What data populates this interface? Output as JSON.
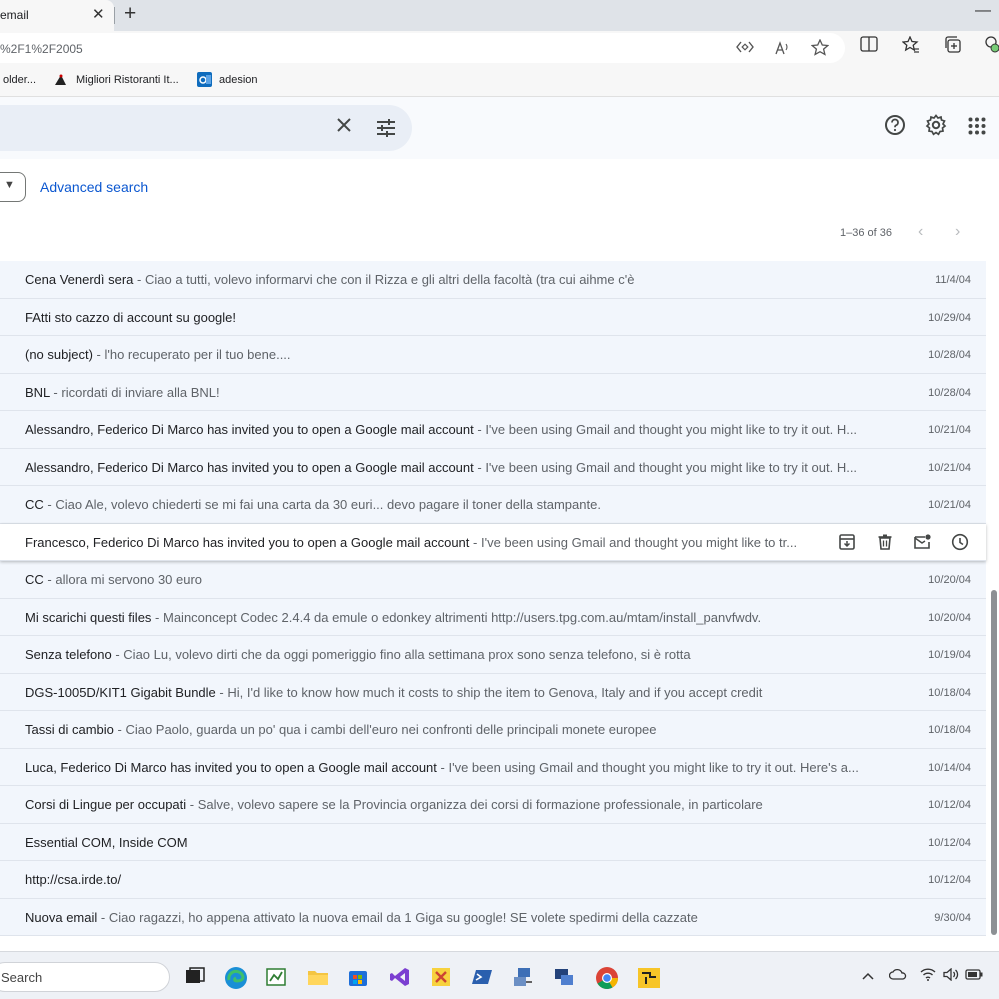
{
  "browser": {
    "tab_title": "email",
    "tab_close": "✕",
    "new_tab": "+",
    "window_minimize": "—",
    "url": "%2F1%2F2005"
  },
  "bookmarks": [
    {
      "label": "older...",
      "icon": "bookmark-icon"
    },
    {
      "label": "Migliori Ristoranti It...",
      "icon": "restaurant-icon"
    },
    {
      "label": "adesion",
      "icon": "outlook-icon"
    }
  ],
  "filters": {
    "advanced_search": "Advanced search"
  },
  "pagination": {
    "text": "1–36 of 36",
    "prev": "‹",
    "next": "›"
  },
  "emails": [
    {
      "subject": "Cena Venerdì sera",
      "snippet": "Ciao a tutti, volevo informarvi che con il Rizza e gli altri della facoltà (tra cui aihme c'è",
      "date": "11/4/04"
    },
    {
      "subject": "FAtti sto cazzo di account su google!",
      "snippet": "",
      "date": "10/29/04"
    },
    {
      "subject": "(no subject)",
      "snippet": "l'ho recuperato per il tuo bene....",
      "date": "10/28/04"
    },
    {
      "subject": "BNL",
      "snippet": "ricordati di inviare alla BNL!",
      "date": "10/28/04"
    },
    {
      "subject": "Alessandro, Federico Di Marco has invited you to open a Google mail account",
      "snippet": "I've been using Gmail and thought you might like to try it out. H...",
      "date": "10/21/04"
    },
    {
      "subject": "Alessandro, Federico Di Marco has invited you to open a Google mail account",
      "snippet": "I've been using Gmail and thought you might like to try it out. H...",
      "date": "10/21/04"
    },
    {
      "subject": "CC",
      "snippet": "Ciao Ale, volevo chiederti se mi fai una carta da 30 euri... devo pagare il toner della stampante.",
      "date": "10/21/04"
    },
    {
      "subject": "Francesco, Federico Di Marco has invited you to open a Google mail account",
      "snippet": "I've been using Gmail and thought you might like to tr...",
      "date": ""
    },
    {
      "subject": "CC",
      "snippet": "allora mi servono 30 euro",
      "date": "10/20/04"
    },
    {
      "subject": "Mi scarichi questi files",
      "snippet": "Mainconcept Codec 2.4.4 da emule o edonkey altrimenti http://users.tpg.com.au/mtam/install_panvfwdv.",
      "date": "10/20/04"
    },
    {
      "subject": "Senza telefono",
      "snippet": "Ciao Lu, volevo dirti che da oggi pomeriggio fino alla settimana prox sono senza telefono, si è rotta",
      "date": "10/19/04"
    },
    {
      "subject": "DGS-1005D/KIT1 Gigabit Bundle",
      "snippet": "Hi, I'd like to know how much it costs to ship the item to Genova, Italy and if you accept credit",
      "date": "10/18/04"
    },
    {
      "subject": "Tassi di cambio",
      "snippet": "Ciao Paolo, guarda un po' qua i cambi dell'euro nei confronti delle principali monete europee",
      "date": "10/18/04"
    },
    {
      "subject": "Luca, Federico Di Marco has invited you to open a Google mail account",
      "snippet": "I've been using Gmail and thought you might like to try it out. Here's a...",
      "date": "10/14/04"
    },
    {
      "subject": "Corsi di Lingue per occupati",
      "snippet": "Salve, volevo sapere se la Provincia organizza dei corsi di formazione professionale, in particolare",
      "date": "10/12/04"
    },
    {
      "subject": "Essential COM, Inside COM",
      "snippet": "",
      "date": "10/12/04"
    },
    {
      "subject": "http://csa.irde.to/",
      "snippet": "",
      "date": "10/12/04"
    },
    {
      "subject": "Nuova email",
      "snippet": "Ciao ragazzi, ho appena attivato la nuova email da 1 Giga su google! SE volete spedirmi della cazzate",
      "date": "9/30/04"
    }
  ],
  "hovered_row_actions": [
    "archive-icon",
    "delete-icon",
    "mark-unread-icon",
    "snooze-icon"
  ],
  "taskbar": {
    "search_label": "Search"
  },
  "colors": {
    "row_bg": "#f2f6fc",
    "accent_link": "#0b57d0",
    "search_bg": "#e9eef6"
  }
}
